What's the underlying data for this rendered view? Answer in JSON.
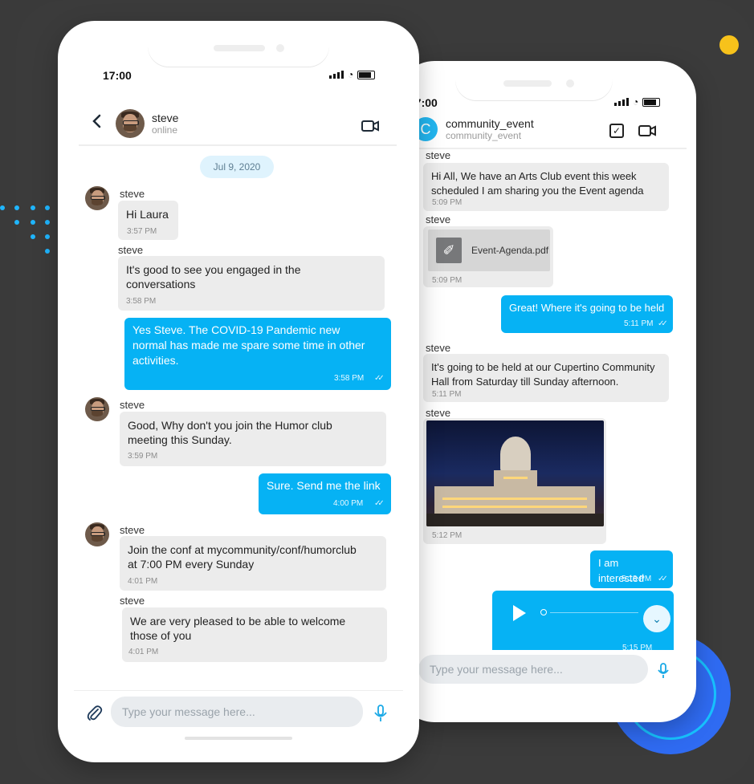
{
  "colors": {
    "accent": "#06b2f4",
    "background": "#3a3a3a",
    "incoming": "#ececec"
  },
  "phone1": {
    "status_time": "17:00",
    "header": {
      "back_icon": "chevron-left",
      "name": "steve",
      "status": "online",
      "video_icon": "video-camera"
    },
    "date_pill": "Jul 9, 2020",
    "messages": [
      {
        "sender": "steve",
        "text": "Hi Laura",
        "time": "3:57 PM"
      },
      {
        "sender": "steve",
        "text_lines": [
          "It's good to see you engaged in the",
          "conversations"
        ],
        "time": "3:58 PM"
      },
      {
        "text_lines": [
          "Yes Steve. The COVID-19 Pandemic new",
          "normal has made me spare some time in other",
          "activities."
        ],
        "time": "3:58 PM"
      },
      {
        "sender": "steve",
        "text_lines": [
          "Good, Why don't you join the Humor club",
          "meeting this Sunday."
        ],
        "time": "3:59 PM"
      },
      {
        "text": "Sure. Send me the link",
        "time": "4:00 PM"
      },
      {
        "sender": "steve",
        "text_lines": [
          "Join the conf at mycommunity/conf/humorclub",
          "at 7:00 PM every Sunday"
        ],
        "time": "4:01 PM"
      },
      {
        "sender": "steve",
        "text_lines": [
          "We are very pleased to be able to welcome",
          "those of you"
        ],
        "time": "4:01 PM"
      }
    ],
    "composer": {
      "placeholder": "Type your message here...",
      "attach_icon": "paperclip",
      "mic_icon": "microphone"
    }
  },
  "phone2": {
    "status_time": "17:00",
    "header": {
      "avatar_letter": "C",
      "name": "community_event",
      "sub": "community_event",
      "check_icon": "checkbox",
      "video_icon": "video-camera"
    },
    "messages": [
      {
        "sender": "steve",
        "text_lines": [
          "Hi All, We have an Arts Club event this week",
          "scheduled I am sharing you the Event agenda"
        ],
        "time": "5:09 PM"
      },
      {
        "sender": "steve",
        "file": "Event-Agenda.pdf",
        "time": "5:09 PM"
      },
      {
        "text": "Great! Where it's going to be held",
        "time": "5:11 PM"
      },
      {
        "sender": "steve",
        "text_lines": [
          "It's going to be held at our Cupertino Community",
          "Hall from  Saturday till Sunday afternoon."
        ],
        "time": "5:11 PM"
      },
      {
        "sender": "steve",
        "image": "city-hall-night-photo",
        "time": "5:12 PM"
      },
      {
        "text": "I am interested",
        "time": "5:13 PM"
      },
      {
        "audio": "voice-message",
        "time": "5:15 PM"
      }
    ],
    "composer": {
      "placeholder": "Type your message here...",
      "mic_icon": "microphone"
    }
  }
}
